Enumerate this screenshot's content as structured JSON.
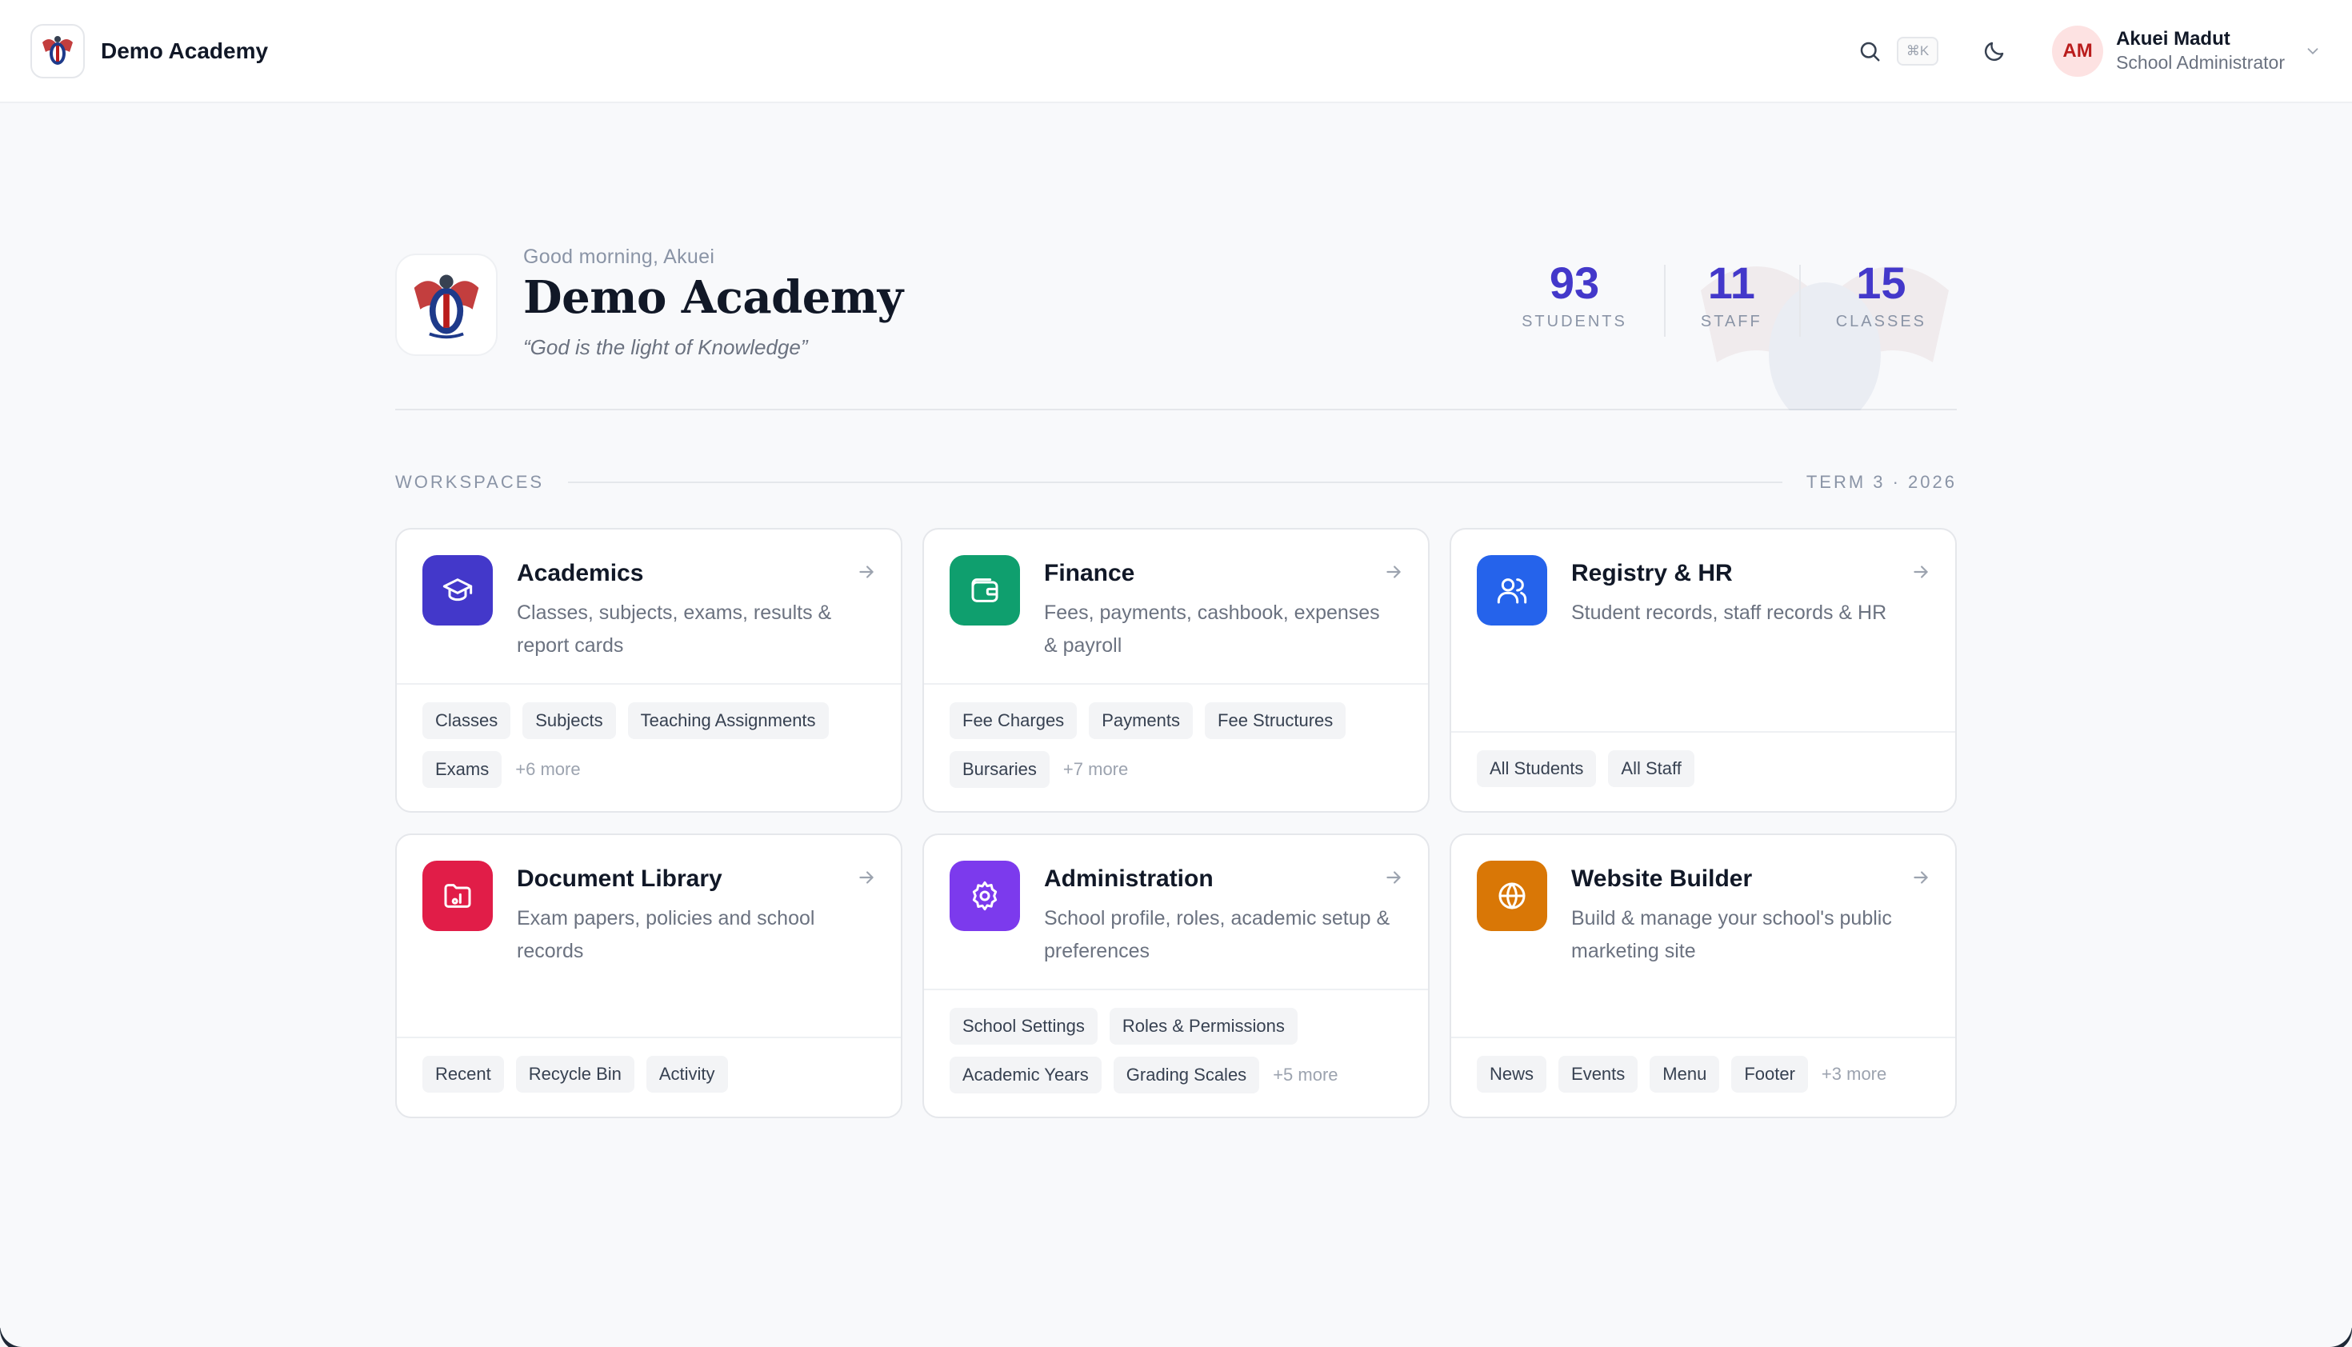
{
  "app": {
    "name": "Demo Academy"
  },
  "topbar": {
    "shortcut": "⌘K",
    "user": {
      "initials": "AM",
      "name": "Akuei Madut",
      "role": "School Administrator"
    }
  },
  "hero": {
    "greeting": "Good morning, Akuei",
    "school_name": "Demo Academy",
    "motto": "“God is the light of Knowledge”",
    "stats": [
      {
        "value": "93",
        "label": "STUDENTS"
      },
      {
        "value": "11",
        "label": "STAFF"
      },
      {
        "value": "15",
        "label": "CLASSES"
      }
    ]
  },
  "section": {
    "title": "WORKSPACES",
    "term": "TERM 3 · 2026"
  },
  "colors": {
    "academics": "#4338ca",
    "finance": "#0f9f6e",
    "registry": "#2563eb",
    "documents": "#e11d48",
    "administration": "#7c3aed",
    "website": "#d97706",
    "accent": "#4338ca"
  },
  "cards": [
    {
      "id": "academics",
      "title": "Academics",
      "description": "Classes, subjects, exams, results & report cards",
      "icon": "graduation-cap-icon",
      "links": [
        "Classes",
        "Subjects",
        "Teaching Assignments",
        "Exams"
      ],
      "more": "+6 more"
    },
    {
      "id": "finance",
      "title": "Finance",
      "description": "Fees, payments, cashbook, expenses & payroll",
      "icon": "wallet-icon",
      "links": [
        "Fee Charges",
        "Payments",
        "Fee Structures",
        "Bursaries"
      ],
      "more": "+7 more"
    },
    {
      "id": "registry",
      "title": "Registry & HR",
      "description": "Student records, staff records & HR",
      "icon": "users-icon",
      "links": [
        "All Students",
        "All Staff"
      ],
      "more": ""
    },
    {
      "id": "documents",
      "title": "Document Library",
      "description": "Exam papers, policies and school records",
      "icon": "folder-icon",
      "links": [
        "Recent",
        "Recycle Bin",
        "Activity"
      ],
      "more": ""
    },
    {
      "id": "administration",
      "title": "Administration",
      "description": "School profile, roles, academic setup & preferences",
      "icon": "gear-icon",
      "links": [
        "School Settings",
        "Roles & Permissions",
        "Academic Years",
        "Grading Scales"
      ],
      "more": "+5 more"
    },
    {
      "id": "website",
      "title": "Website Builder",
      "description": "Build & manage your school's public marketing site",
      "icon": "globe-icon",
      "links": [
        "News",
        "Events",
        "Menu",
        "Footer"
      ],
      "more": "+3 more"
    }
  ]
}
